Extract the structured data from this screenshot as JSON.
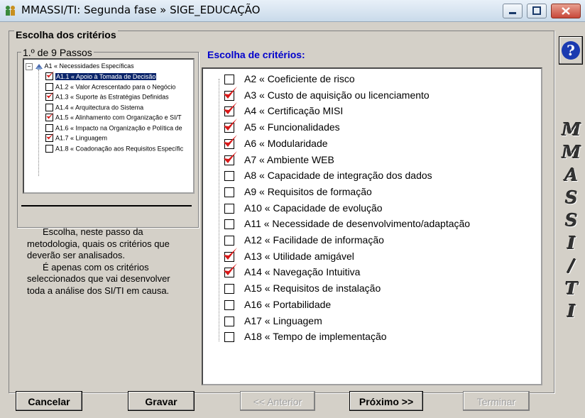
{
  "window": {
    "title": "MMASSI/TI: Segunda fase » SIGE_EDUCAÇÃO"
  },
  "group": {
    "title": "Escolha dos critérios",
    "steps_title": "1.º de 9 Passos"
  },
  "tree": {
    "root": "A1 « Necessidades Específicas",
    "items": [
      {
        "label": "A1.1 « Apoio à Tomada de Decisão",
        "checked": true,
        "selected": true
      },
      {
        "label": "A1.2 « Valor Acrescentado para o Negócio",
        "checked": false
      },
      {
        "label": "A1.3 « Suporte às Estratégias Definidas",
        "checked": true
      },
      {
        "label": "A1.4 « Arquitectura do Sistema",
        "checked": false
      },
      {
        "label": "A1.5 « Alinhamento com Organização e SI/T",
        "checked": true
      },
      {
        "label": "A1.6 « Impacto na Organização e Política de",
        "checked": false
      },
      {
        "label": "A1.7 « Linguagem",
        "checked": true
      },
      {
        "label": "A1.8 « Coadonação aos Requisitos Específic",
        "checked": false
      }
    ]
  },
  "description": {
    "p1": "Escolha, neste passo da metodologia, quais os critérios que deverão ser analisados.",
    "p2": "É apenas com os critérios seleccionados que vai desenvolver toda a análise dos SI/TI em causa."
  },
  "criteria": {
    "title": "Escolha de critérios:",
    "items": [
      {
        "label": "A2 « Coeficiente de risco",
        "checked": false
      },
      {
        "label": "A3 « Custo de aquisição ou licenciamento",
        "checked": true
      },
      {
        "label": "A4 « Certificação MISI",
        "checked": true
      },
      {
        "label": "A5 « Funcionalidades",
        "checked": true
      },
      {
        "label": "A6 « Modularidade",
        "checked": true
      },
      {
        "label": "A7 « Ambiente WEB",
        "checked": true
      },
      {
        "label": "A8 « Capacidade de integração dos dados",
        "checked": false
      },
      {
        "label": "A9 « Requisitos de formação",
        "checked": false
      },
      {
        "label": "A10 « Capacidade de evolução",
        "checked": false
      },
      {
        "label": "A11 « Necessidade de desenvolvimento/adaptação",
        "checked": false
      },
      {
        "label": "A12 « Facilidade de informação",
        "checked": false
      },
      {
        "label": "A13 « Utilidade amigável",
        "checked": true
      },
      {
        "label": "A14 « Navegação Intuitiva",
        "checked": true
      },
      {
        "label": "A15 « Requisitos de instalação",
        "checked": false
      },
      {
        "label": "A16 « Portabilidade",
        "checked": false
      },
      {
        "label": "A17 « Linguagem",
        "checked": false
      },
      {
        "label": "A18 « Tempo de implementação",
        "checked": false
      }
    ]
  },
  "side_logo": [
    "M",
    "M",
    "A",
    "S",
    "S",
    "I",
    "/",
    "T",
    "I"
  ],
  "buttons": {
    "cancel": "Cancelar",
    "save": "Gravar",
    "previous": "<< Anterior",
    "next": "Próximo >>",
    "finish": "Terminar"
  },
  "help": {
    "label": "?"
  },
  "colors": {
    "accent": "#0000cc",
    "check_red": "#d81818",
    "selection": "#0a246a"
  }
}
